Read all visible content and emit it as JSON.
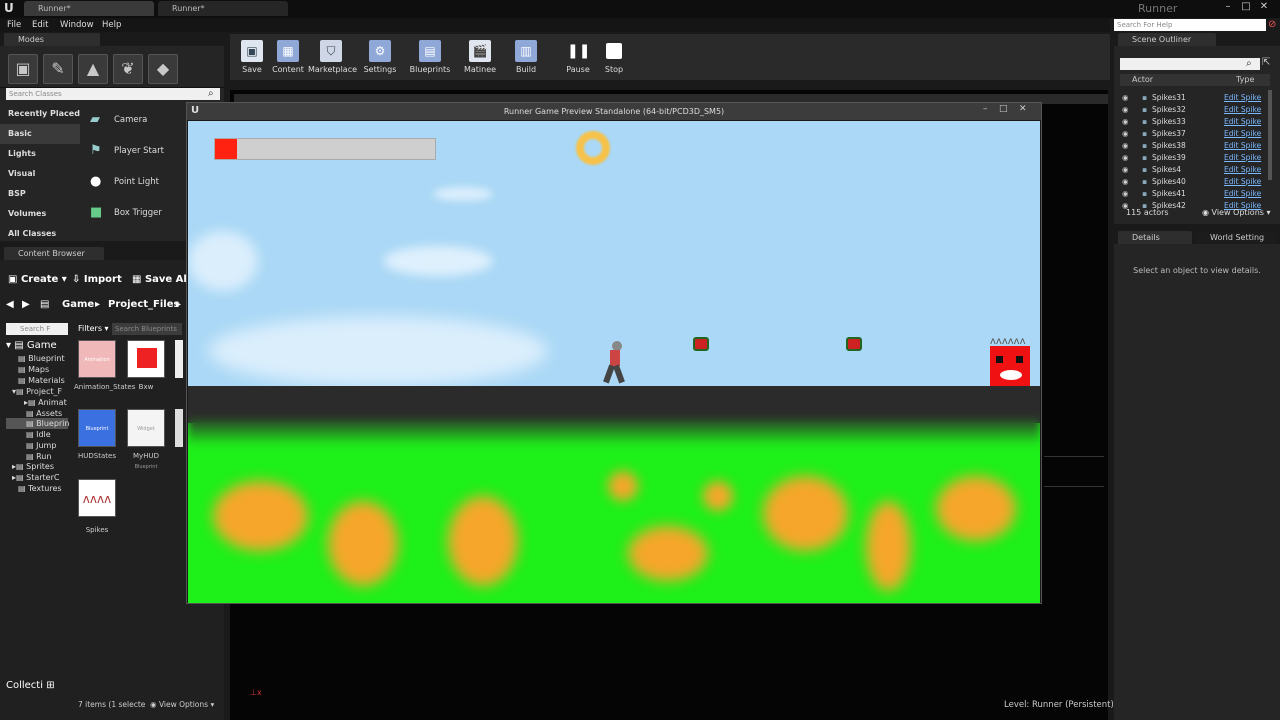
{
  "window": {
    "tabs": [
      "Runner*",
      "Runner*"
    ],
    "app_title": "Runner",
    "help_search_placeholder": "Search For Help"
  },
  "menu": [
    "File",
    "Edit",
    "Window",
    "Help"
  ],
  "modes": {
    "tab": "Modes",
    "search_placeholder": "Search Classes",
    "categories": [
      "Recently Placed",
      "Basic",
      "Lights",
      "Visual",
      "BSP",
      "Volumes",
      "All Classes"
    ],
    "items": [
      "Camera",
      "Player Start",
      "Point Light",
      "Box Trigger"
    ]
  },
  "content_browser": {
    "tab": "Content Browser",
    "create": "Create",
    "import": "Import",
    "save_all": "Save All",
    "breadcrumb": [
      "Game",
      "Project_Files"
    ],
    "search_placeholder": "Search F",
    "filters": "Filters",
    "search_blueprints_placeholder": "Search Blueprints",
    "tree": [
      "Game",
      "Blueprint",
      "Maps",
      "Materials",
      "Project_F",
      "Animat",
      "Assets",
      "Blueprin",
      "Idle",
      "Jump",
      "Run",
      "Sprites",
      "StarterC",
      "Textures"
    ],
    "assets": [
      "Animation_States",
      "Bxw",
      "HUDStates",
      "MyHUD",
      "Spikes"
    ],
    "thumb_text": [
      "Animation",
      "Blueprint",
      "Widget Blueprint"
    ],
    "collections": "Collecti",
    "status": "7 items (1 selecte",
    "view_options": "View Options"
  },
  "toolbar": {
    "buttons": [
      "Save",
      "Content",
      "Marketplace",
      "Settings",
      "Blueprints",
      "Matinee",
      "Build",
      "Pause",
      "Stop"
    ]
  },
  "game_window": {
    "title": "Runner Game Preview Standalone (64-bit/PCD3D_SM5)",
    "health_fraction": 0.1
  },
  "viewport": {
    "level": "Level:  Runner (Persistent)"
  },
  "scene_outliner": {
    "tab": "Scene Outliner",
    "col_actor": "Actor",
    "col_type": "Type",
    "rows": [
      {
        "name": "Spikes31",
        "type": "Edit Spike"
      },
      {
        "name": "Spikes32",
        "type": "Edit Spike"
      },
      {
        "name": "Spikes33",
        "type": "Edit Spike"
      },
      {
        "name": "Spikes37",
        "type": "Edit Spike"
      },
      {
        "name": "Spikes38",
        "type": "Edit Spike"
      },
      {
        "name": "Spikes39",
        "type": "Edit Spike"
      },
      {
        "name": "Spikes4",
        "type": "Edit Spike"
      },
      {
        "name": "Spikes40",
        "type": "Edit Spike"
      },
      {
        "name": "Spikes41",
        "type": "Edit Spike"
      },
      {
        "name": "Spikes42",
        "type": "Edit Spike"
      }
    ],
    "count": "115 actors",
    "view_options": "View Options"
  },
  "details": {
    "tab": "Details",
    "tab2": "World Setting",
    "empty_text": "Select an object to view details."
  }
}
